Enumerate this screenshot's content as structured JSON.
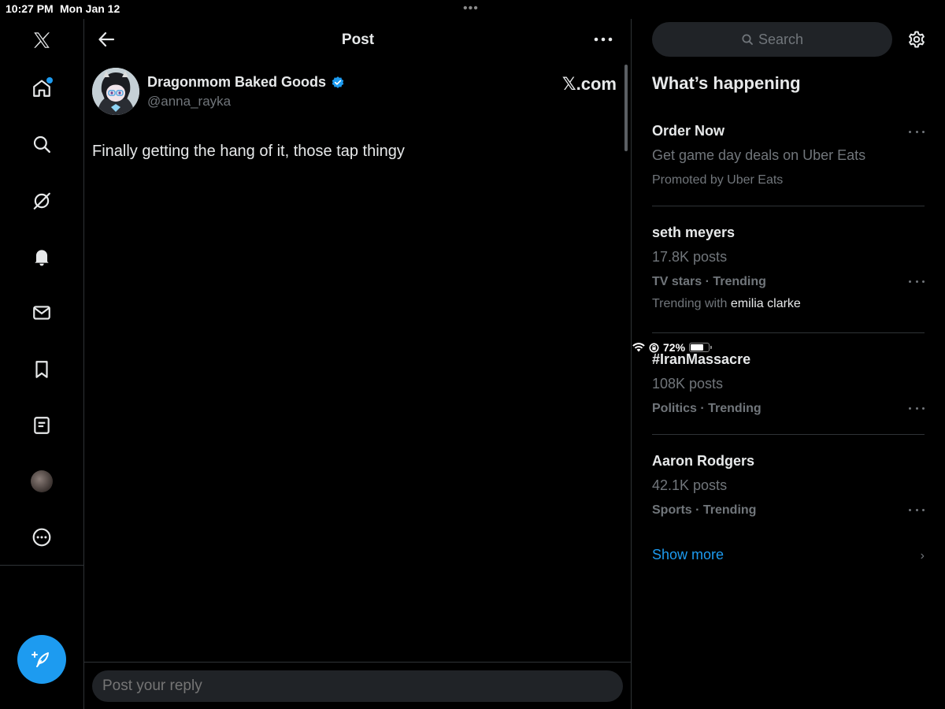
{
  "status": {
    "time": "10:27 PM",
    "date": "Mon Jan 12",
    "battery": "72%",
    "battery_fraction": 0.72
  },
  "nav": {
    "items": [
      "x-logo",
      "home-icon",
      "search-icon",
      "grok-icon",
      "notifications-icon",
      "messages-icon",
      "bookmarks-icon",
      "lists-icon",
      "profile-avatar",
      "more-icon"
    ],
    "home_unread": true
  },
  "header": {
    "title": "Post"
  },
  "post": {
    "author_name": "Dragonmom Baked Goods",
    "author_handle": "@anna_rayka",
    "source_label": "𝕏.com",
    "text": "Finally getting the hang of it, those tap thingy"
  },
  "reply": {
    "placeholder": "Post your reply"
  },
  "search": {
    "placeholder": "Search"
  },
  "happening": {
    "title": "What’s happening",
    "trends": [
      {
        "title": "Order Now",
        "line2": "Get game day deals on Uber Eats",
        "line3": "Promoted by Uber Eats"
      },
      {
        "title": "seth meyers",
        "line2": "17.8K posts",
        "line3": "TV stars · Trending",
        "line4_prefix": "Trending with ",
        "line4_highlight": "emilia clarke"
      },
      {
        "title": "#IranMassacre",
        "line2": "108K posts",
        "line3": "Politics · Trending"
      },
      {
        "title": "Aaron Rodgers",
        "line2": "42.1K posts",
        "line3": "Sports · Trending"
      }
    ],
    "show_more": "Show more"
  },
  "colors": {
    "accent": "#1d9bf0",
    "background": "#000000",
    "muted": "#71767b",
    "divider": "#2f3336"
  }
}
